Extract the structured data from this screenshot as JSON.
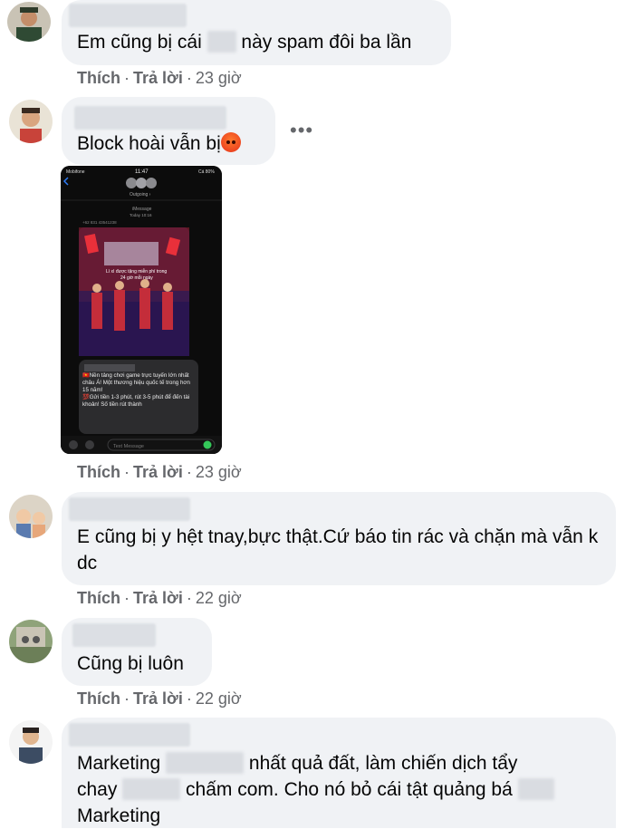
{
  "colors": {
    "bubble": "#f0f2f5",
    "meta": "#65676b",
    "text": "#050505"
  },
  "actions": {
    "like": "Thích",
    "reply": "Trả lời",
    "separator": "·"
  },
  "comments": [
    {
      "text": "Em cũng bị cái",
      "text_after": "này spam đôi ba lần",
      "time": "23 giờ"
    },
    {
      "text": "Block hoài vẫn bị",
      "emoji": "angry-face-icon",
      "time": "23 giờ"
    },
    {
      "text": "E cũng bị y hệt tnay,bực thật.Cứ báo tin rác và chặn mà vẫn k dc",
      "time": "22 giờ"
    },
    {
      "text": "Cũng bị luôn",
      "time": "22 giờ"
    },
    {
      "text_1": "Marketing",
      "text_2": "nhất quả đất, làm chiến dịch tẩy",
      "text_3": "chay",
      "text_4": "chấm com. Cho nó bỏ cái tật quảng bá",
      "text_5": "Marketing"
    }
  ],
  "screenshot": {
    "carrier": "Mobifone",
    "clock": "11:47",
    "battery": "Cá 80%",
    "outgoing": "Outgoing ›",
    "service": "iMessage",
    "date": "Today 10:16",
    "sender": "+62 831 43541238",
    "banner_line1": "Lì xì được tặng miễn phí trong",
    "banner_line2": "24 giờ mỗi ngày",
    "msg1": "🇻🇳Nền tảng chơi game trực tuyến lớn nhất châu Á! Một thương hiệu quốc tế trong hơn 15 năm!",
    "msg2": "💯Gửi tiền 1-3 phút, rút 3-5 phút để đến tài khoản! Số tiền rút thành",
    "input_placeholder": "Text Message"
  }
}
